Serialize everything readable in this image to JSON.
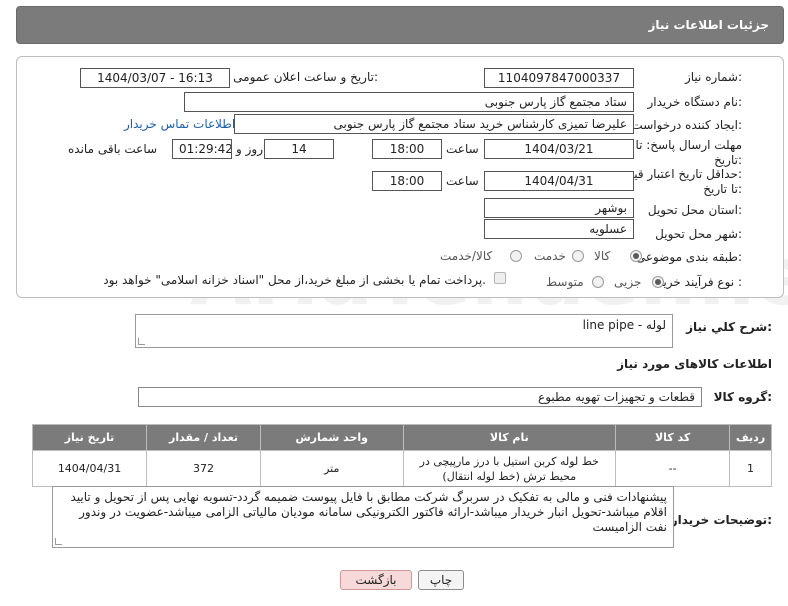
{
  "header": {
    "title": "جزئیات اطلاعات نیاز"
  },
  "form": {
    "need_number_label": "شماره نیاز:",
    "need_number": "1104097847000337",
    "announce_label": "تاریخ و ساعت اعلان عمومی:",
    "announce_value": "1404/03/07 - 16:13",
    "buyer_org_label": "نام دستگاه خریدار:",
    "buyer_org": "ستاد مجتمع گاز پارس جنوبی",
    "requester_label": "ایجاد کننده درخواست:",
    "requester": "علیرضا تمیزی کارشناس خرید ستاد مجتمع گاز پارس جنوبی",
    "buyer_contact_link": "اطلاعات تماس خریدار",
    "reply_deadline_label_1": "مهلت ارسال پاسخ: تا",
    "reply_deadline_label_2": "تاریخ:",
    "reply_date": "1404/03/21",
    "time_label": "ساعت",
    "reply_time": "18:00",
    "days_value": "14",
    "days_label": "روز و",
    "remaining_value": "01:29:42",
    "remaining_label": "ساعت باقی مانده",
    "price_validity_label_1": "حداقل تاریخ اعتبار قیمت:",
    "price_validity_label_2": "تا تاریخ:",
    "price_date": "1404/04/31",
    "price_time": "18:00",
    "delivery_province_label": "استان محل تحویل:",
    "delivery_province": "بوشهر",
    "delivery_city_label": "شهر محل تحویل:",
    "delivery_city": "عسلویه",
    "category_label": "طبقه بندی موضوعی:",
    "category_options": [
      "کالا",
      "خدمت",
      "کالا/خدمت"
    ],
    "purchase_process_label": "نوع فرآیند خرید :",
    "purchase_options": [
      "جزیی",
      "متوسط"
    ],
    "payment_note": "پرداخت تمام یا بخشی از مبلغ خرید،از محل \"اسناد خزانه اسلامی\" خواهد بود."
  },
  "description": {
    "label": "شرح کلي نياز:",
    "value": "لوله - line pipe"
  },
  "goods_section_title": "اطلاعات کالاهای مورد نیاز",
  "goods_group": {
    "label": "گروه کالا:",
    "value": "قطعات و تجهیزات تهویه مطبوع"
  },
  "table": {
    "headers": [
      "ردیف",
      "کد کالا",
      "نام کالا",
      "واحد شمارش",
      "تعداد / مقدار",
      "تاریخ نیاز"
    ],
    "rows": [
      {
        "index": "1",
        "code": "--",
        "name": "خط لوله کربن استیل با درز مارپیچی در محیط ترش (خط لوله انتقال)",
        "unit": "متر",
        "qty": "372",
        "date": "1404/04/31"
      }
    ]
  },
  "buyer_notes": {
    "label": "توضیحات خریدار:",
    "value": "پیشنهادات فنی و مالی به تفکیک در سربرگ شرکت مطابق با فایل پیوست ضمیمه گردد-تسویه نهایی پس از تحویل و تایید اقلام میباشد-تحویل انبار خریدار میباشد-ارائه فاکتور الکترونیکی سامانه مودیان مالیاتی الزامی میباشد-عضویت در وندور نفت الزامیست"
  },
  "buttons": {
    "print": "چاپ",
    "back": "بازگشت"
  },
  "colors": {
    "header_bg": "#7b7b7b",
    "link": "#1f5fa6",
    "back_bg": "#f7d9d9"
  }
}
